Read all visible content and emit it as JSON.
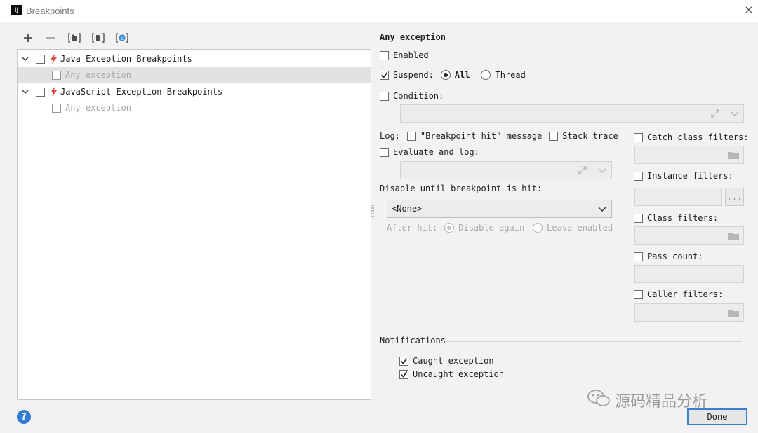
{
  "window": {
    "title": "Breakpoints",
    "app_icon": "IJ",
    "close_glyph": "×"
  },
  "toolbar": {
    "icons": [
      "add-icon",
      "remove-icon",
      "group-by-package-icon",
      "group-by-file-icon",
      "group-by-class-icon"
    ]
  },
  "tree": {
    "groups": [
      {
        "label": "Java Exception Breakpoints",
        "child": "Any exception"
      },
      {
        "label": "JavaScript Exception Breakpoints",
        "child": "Any exception"
      }
    ]
  },
  "details": {
    "heading": "Any exception",
    "enabled": "Enabled",
    "suspend": "Suspend:",
    "suspend_all": "All",
    "suspend_thread": "Thread",
    "condition": "Condition:",
    "log_label": "Log:",
    "log_message": "\"Breakpoint hit\" message",
    "log_stack": "Stack trace",
    "evaluate_and_log": "Evaluate and log:",
    "disable_until": "Disable until breakpoint is hit:",
    "disable_until_value": "<None>",
    "after_hit": "After hit:",
    "disable_again": "Disable again",
    "leave_enabled": "Leave enabled",
    "catch_class_filters": "Catch class filters:",
    "instance_filters": "Instance filters:",
    "instance_more": "...",
    "class_filters": "Class filters:",
    "pass_count": "Pass count:",
    "caller_filters": "Caller filters:",
    "notifications": "Notifications",
    "caught": "Caught exception",
    "uncaught": "Uncaught exception"
  },
  "footer": {
    "done": "Done",
    "help": "?",
    "watermark": "源码精品分析"
  },
  "colors": {
    "accent": "#3c7fd0",
    "bolt": "#e0463c"
  }
}
